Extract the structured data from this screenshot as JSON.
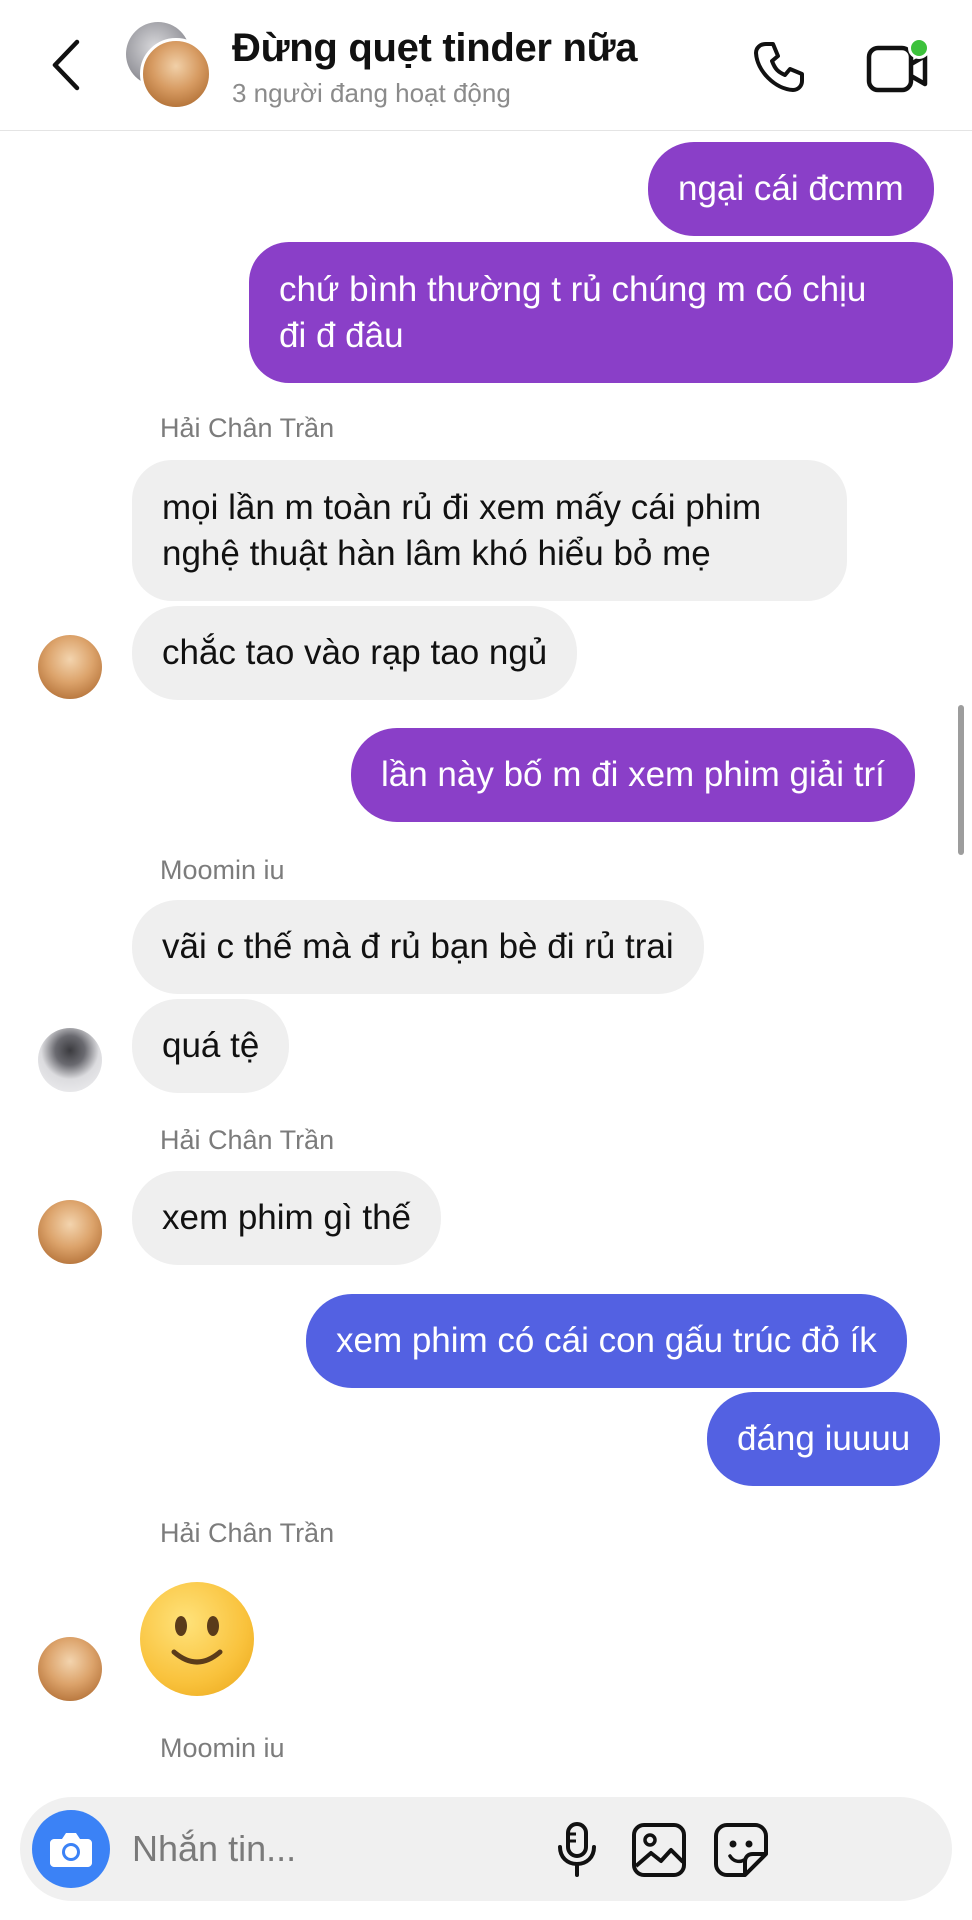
{
  "header": {
    "title": "Đừng quẹt tinder nữa",
    "subtitle": "3 người đang hoạt động",
    "back_icon": "chevron-left-icon",
    "call_icon": "phone-icon",
    "video_icon": "video-call-icon",
    "active_dot_color": "#3cc13b"
  },
  "conversation": {
    "senders": [
      "Hải Chân Trần",
      "Moomin iu",
      "Hải Chân Trần",
      "Hải Chân Trần",
      "Moomin iu"
    ],
    "messages": [
      {
        "from": "me",
        "lines": [
          "ngại cái đcmm"
        ]
      },
      {
        "from": "me",
        "lines": [
          "chứ bình thường t rủ chúng m có chịu",
          "đi đ đâu"
        ]
      },
      {
        "from": "Hải Chân Trần",
        "lines": [
          "mọi lần m toàn rủ đi xem mấy cái phim",
          "nghệ thuật hàn lâm khó hiểu bỏ mẹ"
        ]
      },
      {
        "from": "Hải Chân Trần",
        "lines": [
          "chắc tao vào rạp tao ngủ"
        ]
      },
      {
        "from": "me",
        "lines": [
          "lần này bố m đi xem phim giải trí"
        ]
      },
      {
        "from": "Moomin iu",
        "lines": [
          "vãi c thế mà đ rủ bạn bè đi rủ trai"
        ]
      },
      {
        "from": "Moomin iu",
        "lines": [
          "quá tệ"
        ]
      },
      {
        "from": "Hải Chân Trần",
        "lines": [
          "xem phim gì thế"
        ]
      },
      {
        "from": "me",
        "lines": [
          "xem phim có cái con gấu trúc đỏ ík"
        ]
      },
      {
        "from": "me",
        "lines": [
          "đáng iuuuu"
        ]
      },
      {
        "from": "Hải Chân Trần",
        "emoji": "slightly-smiling-face-emoji"
      }
    ],
    "colors": {
      "outgoing_purple": "#8a3fc8",
      "outgoing_indigo": "#5361e2",
      "incoming": "#efefef"
    }
  },
  "composer": {
    "placeholder": "Nhắn tin...",
    "camera_icon": "camera-icon",
    "mic_icon": "microphone-icon",
    "gallery_icon": "gallery-icon",
    "sticker_icon": "sticker-icon",
    "camera_color": "#3b82f6"
  }
}
